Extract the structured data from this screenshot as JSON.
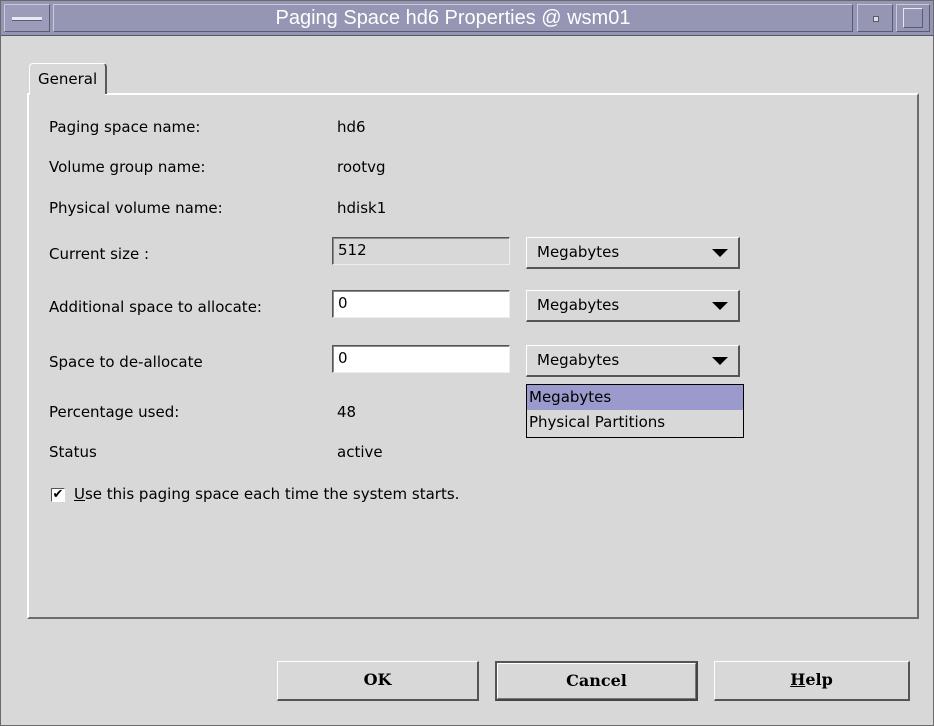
{
  "window": {
    "title": "Paging Space hd6 Properties @ wsm01"
  },
  "tabs": [
    {
      "label": "General",
      "active": true
    }
  ],
  "fields": {
    "paging_space_name": {
      "label": "Paging space name:",
      "value": "hd6"
    },
    "volume_group_name": {
      "label": "Volume group name:",
      "value": "rootvg"
    },
    "physical_volume_name": {
      "label": "Physical volume name:",
      "value": "hdisk1"
    },
    "current_size": {
      "label": "Current size :",
      "value": "512",
      "unit": "Megabytes"
    },
    "additional_space": {
      "label": "Additional space to allocate:",
      "value": "0",
      "unit": "Megabytes"
    },
    "deallocate_space": {
      "label": "Space to de-allocate",
      "value": "0",
      "unit": "Megabytes"
    },
    "percentage_used": {
      "label": "Percentage used:",
      "value": "48"
    },
    "status": {
      "label": "Status",
      "value": "active"
    }
  },
  "unit_dropdown_open": {
    "options": [
      "Megabytes",
      "Physical Partitions"
    ],
    "selected": "Megabytes"
  },
  "startup_checkbox": {
    "checked": true,
    "mnemonic": "U",
    "label_rest": "se this paging space each time the system starts."
  },
  "buttons": {
    "ok": "OK",
    "cancel": "Cancel",
    "help_mnemonic": "H",
    "help_rest": "elp"
  },
  "colors": {
    "titlebar": "#9496b4",
    "background": "#d8d8d8",
    "selection": "#9a9acc"
  }
}
